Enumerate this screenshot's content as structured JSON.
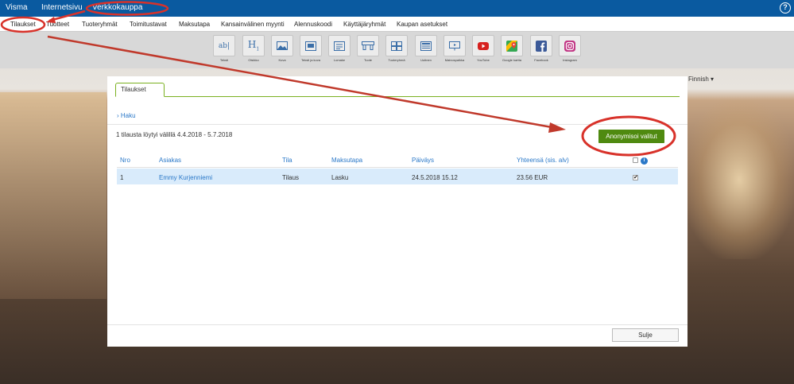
{
  "topbar": {
    "brand": "Visma",
    "nav_internet": "Internetsivu",
    "nav_store": "Verkkokauppa",
    "help": "?"
  },
  "subnav": [
    "Tilaukset",
    "Tuotteet",
    "Tuoteryhmät",
    "Toimitustavat",
    "Maksutapa",
    "Kansainvälinen myynti",
    "Alennuskoodi",
    "Käyttäjäryhmät",
    "Kaupan asetukset"
  ],
  "toolbar": [
    {
      "label": "Teksti",
      "icon": "text-icon"
    },
    {
      "label": "Otsikko",
      "icon": "heading-icon"
    },
    {
      "label": "Kuva",
      "icon": "image-icon"
    },
    {
      "label": "Teksti ja kuva",
      "icon": "text-image-icon"
    },
    {
      "label": "Lomake",
      "icon": "form-icon"
    },
    {
      "label": "Tuote",
      "icon": "product-icon"
    },
    {
      "label": "Tuoteryhmä",
      "icon": "product-group-icon"
    },
    {
      "label": "Uutinen",
      "icon": "news-icon"
    },
    {
      "label": "Mainospaikka",
      "icon": "ad-icon"
    },
    {
      "label": "YouTube",
      "icon": "youtube-icon"
    },
    {
      "label": "Google kartta",
      "icon": "google-maps-icon"
    },
    {
      "label": "Facebook",
      "icon": "facebook-icon"
    },
    {
      "label": "Instagram",
      "icon": "instagram-icon"
    }
  ],
  "language": "Finnish ▾",
  "modal": {
    "tab": "Tilaukset",
    "search_toggle": "Haku",
    "found_text": "1 tilausta löytyi välillä 4.4.2018 - 5.7.2018",
    "anonymize_button": "Anonymisoi valitut",
    "columns": [
      "Nro",
      "Asiakas",
      "Tila",
      "Maksutapa",
      "Päiväys",
      "Yhteensä (sis. alv)"
    ],
    "rows": [
      {
        "nro": "1",
        "customer": "Emmy Kurjenniemi",
        "status": "Tilaus",
        "payment": "Lasku",
        "date": "24.5.2018 15.12",
        "total": "23.56 EUR",
        "selected": true
      }
    ],
    "close_button": "Sulje"
  },
  "colors": {
    "topbar": "#0a5aa0",
    "accent_green": "#4f8a10",
    "link_blue": "#2a78c8",
    "annotation_red": "#d8322a"
  }
}
